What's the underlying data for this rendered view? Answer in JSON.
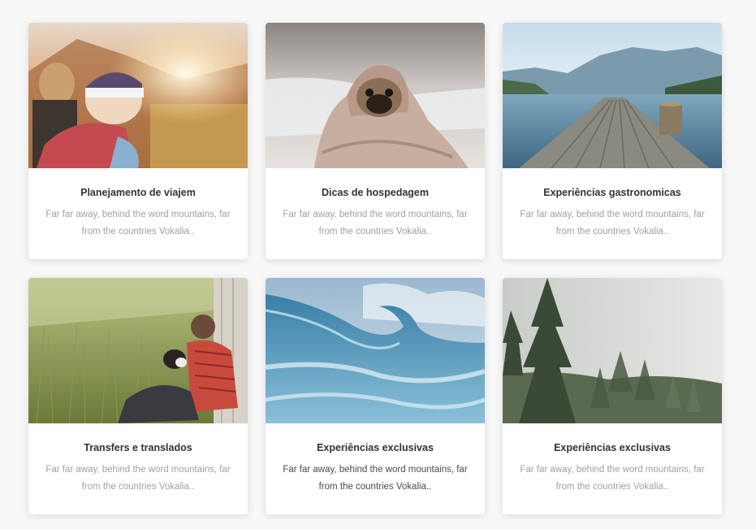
{
  "cards": [
    {
      "title": "Planejamento de viajem",
      "text": "Far far away, behind the word mountains, far from the countries Vokalia..",
      "image_icon": "travel-planning-photo"
    },
    {
      "title": "Dicas de hospedagem",
      "text": "Far far away, behind the word mountains, far from the countries Vokalia..",
      "image_icon": "pug-blanket-photo"
    },
    {
      "title": "Experiências gastronomicas",
      "text": "Far far away, behind the word mountains, far from the countries Vokalia..",
      "image_icon": "lake-pier-photo"
    },
    {
      "title": "Transfers e translados",
      "text": "Far far away, behind the word mountains, far from the countries Vokalia..",
      "image_icon": "man-with-dog-photo"
    },
    {
      "title": "Experiências exclusivas",
      "text": "Far far away, behind the word mountains, far from the countries Vokalia..",
      "image_icon": "ocean-wave-photo"
    },
    {
      "title": "Experiências exclusivas",
      "text": "Far far away, behind the word mountains, far from the countries Vokalia..",
      "image_icon": "misty-forest-photo"
    }
  ],
  "colors": {
    "page_background": "#f8f8f8",
    "card_background": "#ffffff",
    "title": "#333333",
    "text_muted": "#a0a0a0",
    "text_dark": "#4a4a4a"
  }
}
